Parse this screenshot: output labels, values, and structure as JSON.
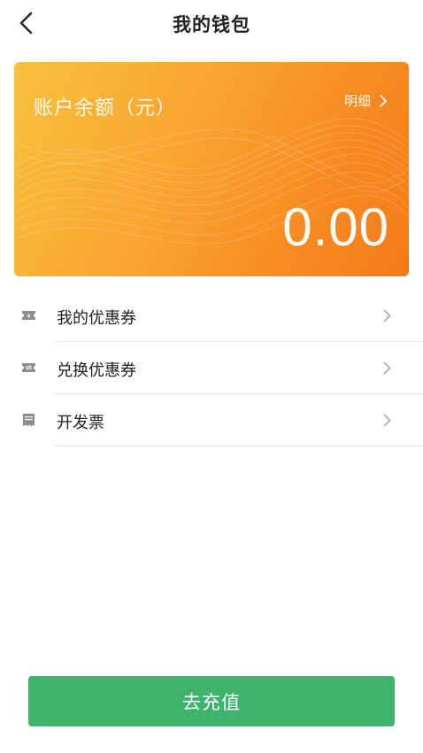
{
  "header": {
    "title": "我的钱包",
    "back_icon": "chevron-left-icon"
  },
  "balance_card": {
    "label": "账户余额（元）",
    "detail_label": "明细",
    "amount": "0.00",
    "gradient_colors": [
      "#f8c03c",
      "#f47c1a"
    ]
  },
  "menu": {
    "items": [
      {
        "label": "我的优惠券",
        "icon": "ticket-icon"
      },
      {
        "label": "兑换优惠券",
        "icon": "exchange-ticket-icon"
      },
      {
        "label": "开发票",
        "icon": "invoice-icon"
      }
    ]
  },
  "footer": {
    "recharge_label": "去充值",
    "button_color": "#3fb36b"
  }
}
